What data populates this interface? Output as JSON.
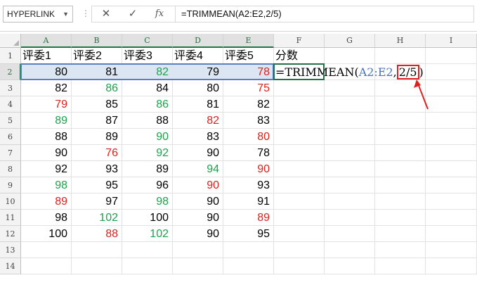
{
  "formula_bar": {
    "name_box": "HYPERLINK",
    "cancel_icon": "✕",
    "enter_icon": "✓",
    "fx_label": "fx",
    "formula": "=TRIMMEAN(A2:E2,2/5)"
  },
  "columns": [
    "A",
    "B",
    "C",
    "D",
    "E",
    "F",
    "G",
    "H",
    "I"
  ],
  "rows": [
    "1",
    "2",
    "3",
    "4",
    "5",
    "6",
    "7",
    "8",
    "9",
    "10",
    "11",
    "12",
    "13",
    "14"
  ],
  "headers": [
    "评委1",
    "评委2",
    "评委3",
    "评委4",
    "评委5",
    "分数"
  ],
  "data": [
    [
      {
        "v": "80",
        "c": ""
      },
      {
        "v": "81",
        "c": ""
      },
      {
        "v": "82",
        "c": "green"
      },
      {
        "v": "79",
        "c": ""
      },
      {
        "v": "78",
        "c": "red"
      }
    ],
    [
      {
        "v": "82",
        "c": ""
      },
      {
        "v": "86",
        "c": "green"
      },
      {
        "v": "84",
        "c": ""
      },
      {
        "v": "80",
        "c": ""
      },
      {
        "v": "75",
        "c": "red"
      }
    ],
    [
      {
        "v": "79",
        "c": "red"
      },
      {
        "v": "85",
        "c": ""
      },
      {
        "v": "86",
        "c": "green"
      },
      {
        "v": "81",
        "c": ""
      },
      {
        "v": "82",
        "c": ""
      }
    ],
    [
      {
        "v": "89",
        "c": "green"
      },
      {
        "v": "87",
        "c": ""
      },
      {
        "v": "88",
        "c": ""
      },
      {
        "v": "82",
        "c": "red"
      },
      {
        "v": "83",
        "c": ""
      }
    ],
    [
      {
        "v": "88",
        "c": ""
      },
      {
        "v": "89",
        "c": ""
      },
      {
        "v": "90",
        "c": "green"
      },
      {
        "v": "83",
        "c": ""
      },
      {
        "v": "80",
        "c": "red"
      }
    ],
    [
      {
        "v": "90",
        "c": ""
      },
      {
        "v": "76",
        "c": "red"
      },
      {
        "v": "92",
        "c": "green"
      },
      {
        "v": "90",
        "c": ""
      },
      {
        "v": "78",
        "c": ""
      }
    ],
    [
      {
        "v": "92",
        "c": ""
      },
      {
        "v": "93",
        "c": ""
      },
      {
        "v": "89",
        "c": ""
      },
      {
        "v": "94",
        "c": "green"
      },
      {
        "v": "90",
        "c": "red"
      }
    ],
    [
      {
        "v": "98",
        "c": "green"
      },
      {
        "v": "95",
        "c": ""
      },
      {
        "v": "96",
        "c": ""
      },
      {
        "v": "90",
        "c": "red"
      },
      {
        "v": "93",
        "c": ""
      }
    ],
    [
      {
        "v": "89",
        "c": "red"
      },
      {
        "v": "97",
        "c": ""
      },
      {
        "v": "98",
        "c": "green"
      },
      {
        "v": "90",
        "c": ""
      },
      {
        "v": "91",
        "c": ""
      }
    ],
    [
      {
        "v": "98",
        "c": ""
      },
      {
        "v": "102",
        "c": "green"
      },
      {
        "v": "100",
        "c": ""
      },
      {
        "v": "90",
        "c": ""
      },
      {
        "v": "89",
        "c": "red"
      }
    ],
    [
      {
        "v": "100",
        "c": ""
      },
      {
        "v": "88",
        "c": "red"
      },
      {
        "v": "102",
        "c": "green"
      },
      {
        "v": "90",
        "c": ""
      },
      {
        "v": "95",
        "c": ""
      }
    ]
  ],
  "editing_cell": {
    "prefix": "=TRIMMEAN(",
    "ref": "A2:E2",
    "comma": ",",
    "arg": "2/5",
    "close": ")"
  },
  "colors": {
    "red": "#e0201b",
    "green": "#1ba34a",
    "ref_blue": "#4672c4",
    "annotation_red": "#e02020"
  }
}
